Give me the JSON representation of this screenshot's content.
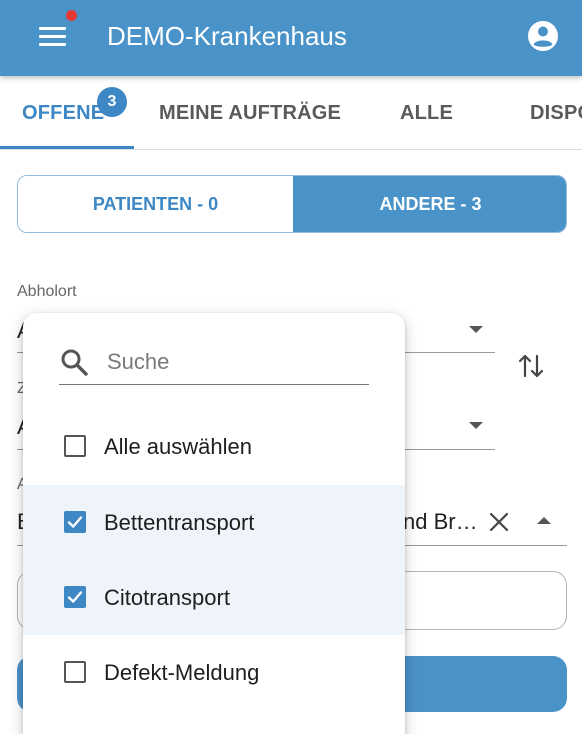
{
  "app": {
    "title": "DEMO-Krankenhaus",
    "colors": {
      "primary": "#4a93c9",
      "accent": "#3d87c4",
      "notification": "#e53935"
    },
    "icons": {
      "menu": "menu-icon",
      "account": "account-circle-icon"
    }
  },
  "tabs": [
    {
      "label": "OFFENE",
      "active": true,
      "badge": "3"
    },
    {
      "label": "MEINE AUFTRÄGE",
      "active": false
    },
    {
      "label": "ALLE",
      "active": false
    },
    {
      "label": "DISPO",
      "active": false
    }
  ],
  "toggle": {
    "left_label": "PATIENTEN - 0",
    "right_label": "ANDERE - 3",
    "selected": "ANDERE - 3"
  },
  "form": {
    "pickup_label": "Abholort",
    "pickup_value_partial": "A",
    "dest_label_partial": "Z",
    "dest_value_partial": "A",
    "type_label_partial": "A",
    "type_value_partial_left": "B",
    "type_value_partial_right": "nd Br…"
  },
  "dropdown": {
    "search_placeholder": "Suche",
    "search_value": "",
    "options": [
      {
        "label": "Alle auswählen",
        "checked": false
      },
      {
        "label": "Bettentransport",
        "checked": true
      },
      {
        "label": "Citotransport",
        "checked": true
      },
      {
        "label": "Defekt-Meldung",
        "checked": false
      }
    ]
  }
}
